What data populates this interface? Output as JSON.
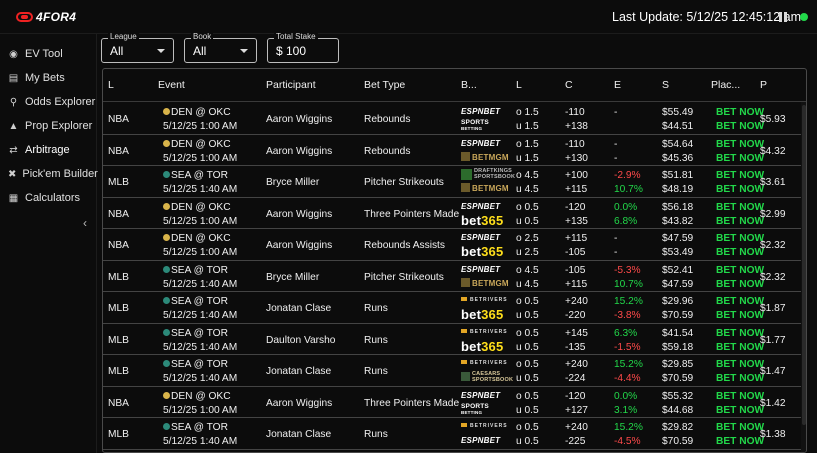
{
  "app": {
    "logo_text": "4FOR4"
  },
  "topbar": {
    "last_update": "Last Update:  5/12/25 12:45:12 am"
  },
  "sidebar": {
    "items": [
      {
        "label": "EV Tool",
        "icon": "pin-icon"
      },
      {
        "label": "My Bets",
        "icon": "receipt-icon"
      },
      {
        "label": "Odds Explorer",
        "icon": "search-icon"
      },
      {
        "label": "Prop Explorer",
        "icon": "filter-icon"
      },
      {
        "label": "Arbitrage",
        "icon": "arrows-icon"
      },
      {
        "label": "Pick'em Builder",
        "icon": "tools-icon"
      },
      {
        "label": "Calculators",
        "icon": "calculator-icon"
      }
    ],
    "active": "Arbitrage"
  },
  "filters": {
    "league": {
      "label": "League",
      "value": "All"
    },
    "book": {
      "label": "Book",
      "value": "All"
    },
    "stake": {
      "label": "Total Stake",
      "value": "$  100"
    }
  },
  "table": {
    "headers": [
      "L",
      "Event",
      "Participant",
      "Bet Type",
      "B...",
      "L",
      "C",
      "E",
      "S",
      "Plac...",
      "P"
    ],
    "rows": [
      {
        "league": "NBA",
        "event_teams": "DEN @ OKC",
        "event_time": "5/12/25 1:00 AM",
        "participant": "Aaron Wiggins",
        "bet_type": "Rebounds",
        "book1": "espn",
        "book2": "sports",
        "line1": "o 1.5",
        "line2": "u 1.5",
        "odds1": "-110",
        "odds2": "+138",
        "ev1": "-",
        "ev2": "",
        "stake1": "$55.49",
        "stake2": "$44.51",
        "place": "BET NOW",
        "profit": "$5.93",
        "icon_a": "nugget",
        "icon_b": "thunder"
      },
      {
        "league": "NBA",
        "event_teams": "DEN @ OKC",
        "event_time": "5/12/25 1:00 AM",
        "participant": "Aaron Wiggins",
        "bet_type": "Rebounds",
        "book1": "espn",
        "book2": "mgm",
        "line1": "o 1.5",
        "line2": "u 1.5",
        "odds1": "-110",
        "odds2": "+130",
        "ev1": "-",
        "ev2": "-",
        "stake1": "$54.64",
        "stake2": "$45.36",
        "place": "BET NOW",
        "profit": "$4.32",
        "icon_a": "nugget",
        "icon_b": "thunder"
      },
      {
        "league": "MLB",
        "event_teams": "SEA @ TOR",
        "event_time": "5/12/25 1:40 AM",
        "participant": "Bryce Miller",
        "bet_type": "Pitcher Strikeouts",
        "book1": "dk",
        "book2": "mgm",
        "line1": "o 4.5",
        "line2": "u 4.5",
        "odds1": "+100",
        "odds2": "+115",
        "ev1": "-2.9%",
        "ev2": "10.7%",
        "stake1": "$51.81",
        "stake2": "$48.19",
        "place": "BET NOW",
        "profit": "$3.61",
        "icon_a": "mariners",
        "icon_b": "jays"
      },
      {
        "league": "NBA",
        "event_teams": "DEN @ OKC",
        "event_time": "5/12/25 1:00 AM",
        "participant": "Aaron Wiggins",
        "bet_type": "Three Pointers Made",
        "book1": "espn",
        "book2": "b365",
        "line1": "o 0.5",
        "line2": "u 0.5",
        "odds1": "-120",
        "odds2": "+135",
        "ev1": "0.0%",
        "ev2": "6.8%",
        "stake1": "$56.18",
        "stake2": "$43.82",
        "place": "BET NOW",
        "profit": "$2.99",
        "icon_a": "nugget",
        "icon_b": "thunder"
      },
      {
        "league": "NBA",
        "event_teams": "DEN @ OKC",
        "event_time": "5/12/25 1:00 AM",
        "participant": "Aaron Wiggins",
        "bet_type": "Rebounds Assists",
        "book1": "espn",
        "book2": "b365",
        "line1": "o 2.5",
        "line2": "u 2.5",
        "odds1": "+115",
        "odds2": "-105",
        "ev1": "-",
        "ev2": "-",
        "stake1": "$47.59",
        "stake2": "$53.49",
        "place": "BET NOW",
        "profit": "$2.32",
        "icon_a": "nugget",
        "icon_b": "thunder"
      },
      {
        "league": "MLB",
        "event_teams": "SEA @ TOR",
        "event_time": "5/12/25 1:40 AM",
        "participant": "Bryce Miller",
        "bet_type": "Pitcher Strikeouts",
        "book1": "espn",
        "book2": "mgm",
        "line1": "o 4.5",
        "line2": "u 4.5",
        "odds1": "-105",
        "odds2": "+115",
        "ev1": "-5.3%",
        "ev2": "10.7%",
        "stake1": "$52.41",
        "stake2": "$47.59",
        "place": "BET NOW",
        "profit": "$2.32",
        "icon_a": "mariners",
        "icon_b": "jays"
      },
      {
        "league": "MLB",
        "event_teams": "SEA @ TOR",
        "event_time": "5/12/25 1:40 AM",
        "participant": "Jonatan Clase",
        "bet_type": "Runs",
        "book1": "riv",
        "book2": "b365",
        "line1": "o 0.5",
        "line2": "u 0.5",
        "odds1": "+240",
        "odds2": "-220",
        "ev1": "15.2%",
        "ev2": "-3.8%",
        "stake1": "$29.96",
        "stake2": "$70.59",
        "place": "BET NOW",
        "profit": "$1.87",
        "icon_a": "mariners",
        "icon_b": "jays"
      },
      {
        "league": "MLB",
        "event_teams": "SEA @ TOR",
        "event_time": "5/12/25 1:40 AM",
        "participant": "Daulton Varsho",
        "bet_type": "Runs",
        "book1": "riv",
        "book2": "b365",
        "line1": "o 0.5",
        "line2": "u 0.5",
        "odds1": "+145",
        "odds2": "-135",
        "ev1": "6.3%",
        "ev2": "-1.5%",
        "stake1": "$41.54",
        "stake2": "$59.18",
        "place": "BET NOW",
        "profit": "$1.77",
        "icon_a": "mariners",
        "icon_b": "jays"
      },
      {
        "league": "MLB",
        "event_teams": "SEA @ TOR",
        "event_time": "5/12/25 1:40 AM",
        "participant": "Jonatan Clase",
        "bet_type": "Runs",
        "book1": "riv",
        "book2": "caesars",
        "line1": "o 0.5",
        "line2": "u 0.5",
        "odds1": "+240",
        "odds2": "-224",
        "ev1": "15.2%",
        "ev2": "-4.4%",
        "stake1": "$29.85",
        "stake2": "$70.59",
        "place": "BET NOW",
        "profit": "$1.47",
        "icon_a": "mariners",
        "icon_b": "jays"
      },
      {
        "league": "NBA",
        "event_teams": "DEN @ OKC",
        "event_time": "5/12/25 1:00 AM",
        "participant": "Aaron Wiggins",
        "bet_type": "Three Pointers Made",
        "book1": "espn",
        "book2": "sports",
        "line1": "o 0.5",
        "line2": "u 0.5",
        "odds1": "-120",
        "odds2": "+127",
        "ev1": "0.0%",
        "ev2": "3.1%",
        "stake1": "$55.32",
        "stake2": "$44.68",
        "place": "BET NOW",
        "profit": "$1.42",
        "icon_a": "nugget",
        "icon_b": "thunder"
      },
      {
        "league": "MLB",
        "event_teams": "SEA @ TOR",
        "event_time": "5/12/25 1:40 AM",
        "participant": "Jonatan Clase",
        "bet_type": "Runs",
        "book1": "riv",
        "book2": "espn",
        "line1": "o 0.5",
        "line2": "u 0.5",
        "odds1": "+240",
        "odds2": "-225",
        "ev1": "15.2%",
        "ev2": "-4.5%",
        "stake1": "$29.82",
        "stake2": "$70.59",
        "place": "BET NOW",
        "profit": "$1.38",
        "icon_a": "mariners",
        "icon_b": "jays"
      }
    ]
  },
  "books": {
    "espn": {
      "a": "ESPN",
      "b": "BET"
    },
    "sports": {
      "a": "SPORTS",
      "b": "BETTING"
    },
    "mgm": {
      "a": "BETMGM"
    },
    "b365": {
      "a": "bet",
      "b": "365"
    },
    "dk": {
      "a": "DRAFTKINGS",
      "b": "SPORTSBOOK"
    },
    "riv": {
      "a": "BETRIVERS"
    },
    "caesars": {
      "a": "CAESARS",
      "b": "SPORTSBOOK"
    }
  },
  "colors": {
    "positive": "#22d84a",
    "negative": "#ff4a4a",
    "accent_red": "#e22222",
    "live": "#22d84a"
  }
}
